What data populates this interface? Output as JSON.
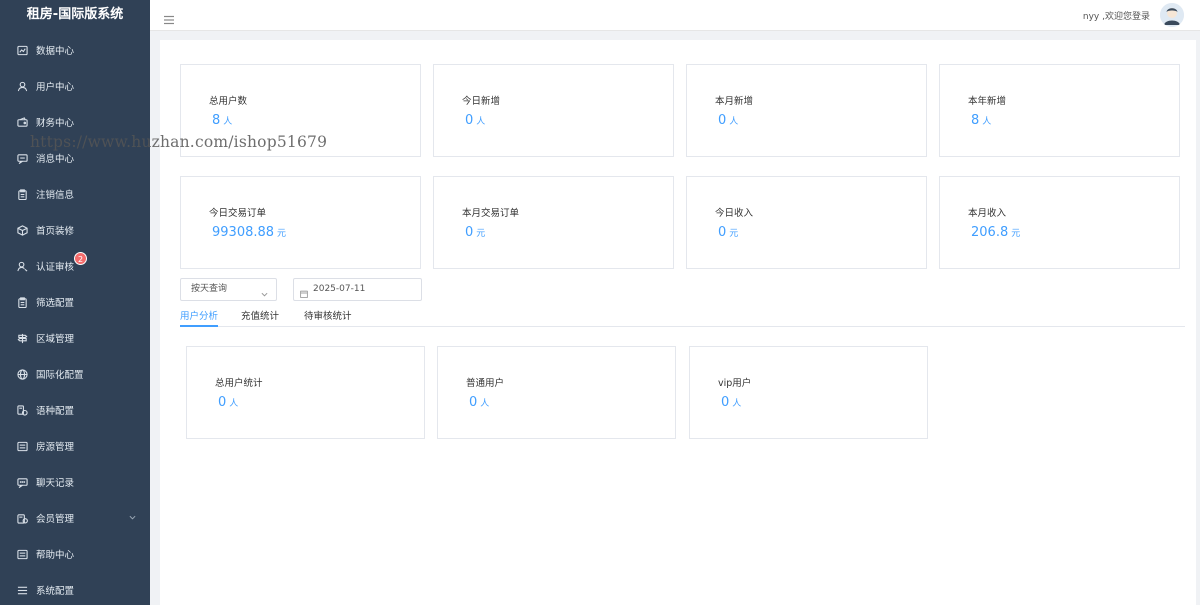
{
  "sidebar": {
    "brand": "租房-国际版系统",
    "items": [
      {
        "label": "数据中心",
        "icon": "dashboard-icon"
      },
      {
        "label": "用户中心",
        "icon": "user-icon"
      },
      {
        "label": "财务中心",
        "icon": "wallet-icon"
      },
      {
        "label": "消息中心",
        "icon": "message-icon"
      },
      {
        "label": "注销信息",
        "icon": "clipboard-icon"
      },
      {
        "label": "首页装修",
        "icon": "cube-icon"
      },
      {
        "label": "认证审核",
        "icon": "user-check-icon",
        "badge": "2"
      },
      {
        "label": "筛选配置",
        "icon": "clipboard-icon"
      },
      {
        "label": "区域管理",
        "icon": "signpost-icon"
      },
      {
        "label": "国际化配置",
        "icon": "globe-icon"
      },
      {
        "label": "语种配置",
        "icon": "language-icon"
      },
      {
        "label": "房源管理",
        "icon": "list-box-icon"
      },
      {
        "label": "聊天记录",
        "icon": "chat-icon"
      },
      {
        "label": "会员管理",
        "icon": "member-icon",
        "has_submenu": true
      },
      {
        "label": "帮助中心",
        "icon": "help-box-icon"
      },
      {
        "label": "系统配置",
        "icon": "settings-list-icon"
      }
    ]
  },
  "header": {
    "welcome": "nyy ,欢迎您登录"
  },
  "stats_row1": [
    {
      "label": "总用户数",
      "value": "8",
      "unit": "人"
    },
    {
      "label": "今日新增",
      "value": "0",
      "unit": "人"
    },
    {
      "label": "本月新增",
      "value": "0",
      "unit": "人"
    },
    {
      "label": "本年新增",
      "value": "8",
      "unit": "人"
    }
  ],
  "stats_row2": [
    {
      "label": "今日交易订单",
      "value": "99308.88",
      "unit": "元"
    },
    {
      "label": "本月交易订单",
      "value": "0",
      "unit": "元"
    },
    {
      "label": "今日收入",
      "value": "0",
      "unit": "元"
    },
    {
      "label": "本月收入",
      "value": "206.8",
      "unit": "元"
    }
  ],
  "filter": {
    "query_mode": "按天查询",
    "date": "2025-07-11"
  },
  "tabs": [
    {
      "label": "用户分析",
      "active": true
    },
    {
      "label": "充值统计",
      "active": false
    },
    {
      "label": "待审核统计",
      "active": false
    }
  ],
  "user_stats": [
    {
      "label": "总用户统计",
      "value": "0",
      "unit": "人"
    },
    {
      "label": "普通用户",
      "value": "0",
      "unit": "人"
    },
    {
      "label": "vip用户",
      "value": "0",
      "unit": "人"
    }
  ],
  "watermark": "https://www.huzhan.com/ishop51679",
  "colors": {
    "sidebar_bg": "#304156",
    "accent": "#409eff",
    "badge": "#f56c6c"
  }
}
